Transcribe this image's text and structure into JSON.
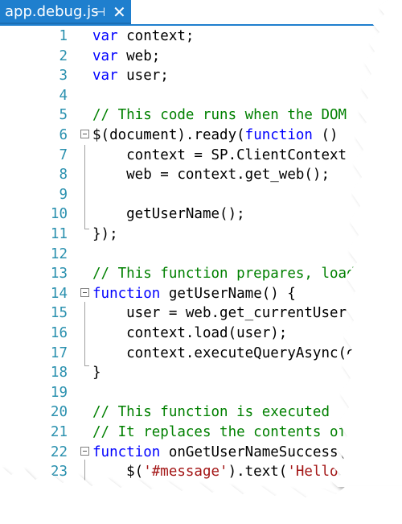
{
  "tab": {
    "title": "app.debug.js",
    "pin_glyph": "⊣",
    "close_glyph": "✕"
  },
  "lines": [
    {
      "n": "1",
      "code": [
        [
          "kw",
          "var"
        ],
        [
          "tx",
          " context;"
        ]
      ]
    },
    {
      "n": "2",
      "code": [
        [
          "kw",
          "var"
        ],
        [
          "tx",
          " web;"
        ]
      ]
    },
    {
      "n": "3",
      "code": [
        [
          "kw",
          "var"
        ],
        [
          "tx",
          " user;"
        ]
      ]
    },
    {
      "n": "4",
      "code": []
    },
    {
      "n": "5",
      "code": [
        [
          "cm",
          "// This code runs when the DOM"
        ]
      ]
    },
    {
      "n": "6",
      "code": [
        [
          "tx",
          "$(document).ready("
        ],
        [
          "kw",
          "function"
        ],
        [
          "tx",
          " ()"
        ]
      ]
    },
    {
      "n": "7",
      "code": [
        [
          "tx",
          "    context = SP.ClientContext"
        ]
      ]
    },
    {
      "n": "8",
      "code": [
        [
          "tx",
          "    web = context.get_web();"
        ]
      ]
    },
    {
      "n": "9",
      "code": []
    },
    {
      "n": "10",
      "code": [
        [
          "tx",
          "    getUserName();"
        ]
      ]
    },
    {
      "n": "11",
      "code": [
        [
          "tx",
          "});"
        ]
      ]
    },
    {
      "n": "12",
      "code": []
    },
    {
      "n": "13",
      "code": [
        [
          "cm",
          "// This function prepares, loads"
        ]
      ]
    },
    {
      "n": "14",
      "code": [
        [
          "kw",
          "function"
        ],
        [
          "tx",
          " getUserName() {"
        ]
      ]
    },
    {
      "n": "15",
      "code": [
        [
          "tx",
          "    user = web.get_currentUser"
        ]
      ]
    },
    {
      "n": "16",
      "code": [
        [
          "tx",
          "    context.load(user);"
        ]
      ]
    },
    {
      "n": "17",
      "code": [
        [
          "tx",
          "    context.executeQueryAsync(on"
        ]
      ]
    },
    {
      "n": "18",
      "code": [
        [
          "tx",
          "}"
        ]
      ]
    },
    {
      "n": "19",
      "code": []
    },
    {
      "n": "20",
      "code": [
        [
          "cm",
          "// This function is executed"
        ]
      ]
    },
    {
      "n": "21",
      "code": [
        [
          "cm",
          "// It replaces the contents of"
        ]
      ]
    },
    {
      "n": "22",
      "code": [
        [
          "kw",
          "function"
        ],
        [
          "tx",
          " onGetUserNameSuccess()"
        ]
      ]
    },
    {
      "n": "23",
      "code": [
        [
          "tx",
          "    $("
        ],
        [
          "st",
          "'#message'"
        ],
        [
          "tx",
          ").text("
        ],
        [
          "st",
          "'Hello"
        ]
      ]
    }
  ]
}
